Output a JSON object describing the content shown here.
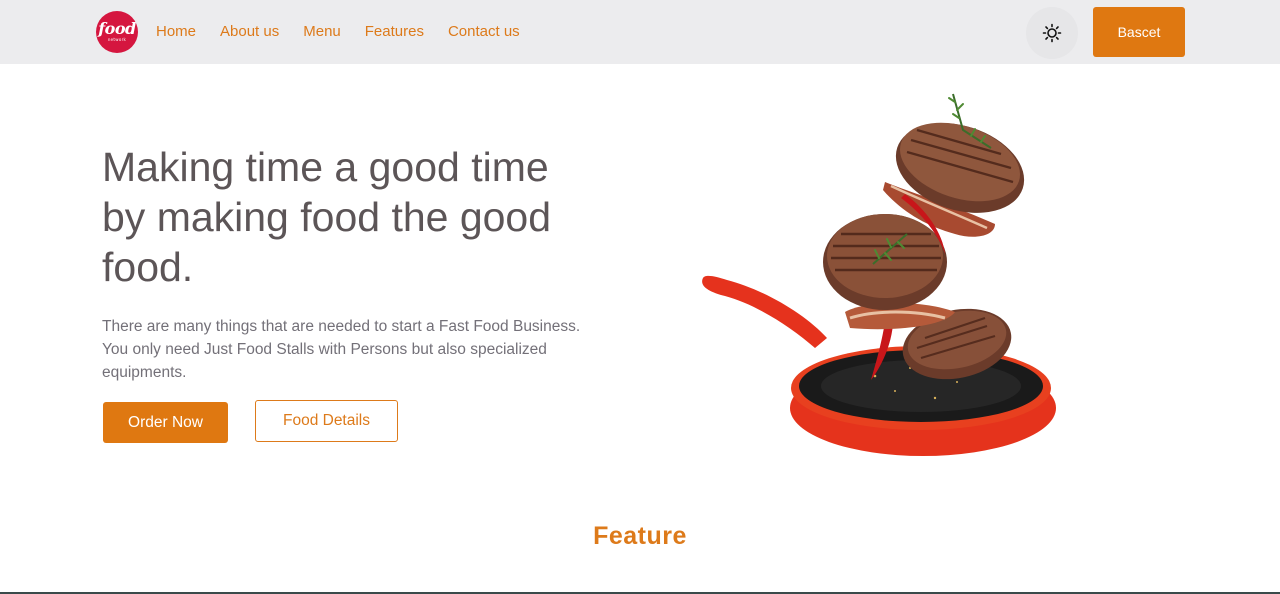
{
  "navbar": {
    "logo": {
      "word": "food",
      "sub": "network"
    },
    "links": [
      "Home",
      "About us",
      "Menu",
      "Features",
      "Contact us"
    ],
    "theme_icon": "sun-icon",
    "basket_label": "Bascet"
  },
  "hero": {
    "title": "Making time a good time by making food the good food.",
    "description": "There are many things that are needed to start a Fast Food Business. You only need Just Food Stalls with Persons but also specialized equipments.",
    "order_label": "Order Now",
    "details_label": "Food Details",
    "image_icon": "frying-pan-with-steaks-image"
  },
  "features": {
    "title": "Feature"
  },
  "colors": {
    "accent": "#df7811",
    "navbar_bg": "#ececee",
    "heading": "#5c5557",
    "body_text": "#737078",
    "logo_red": "#d5163f"
  }
}
